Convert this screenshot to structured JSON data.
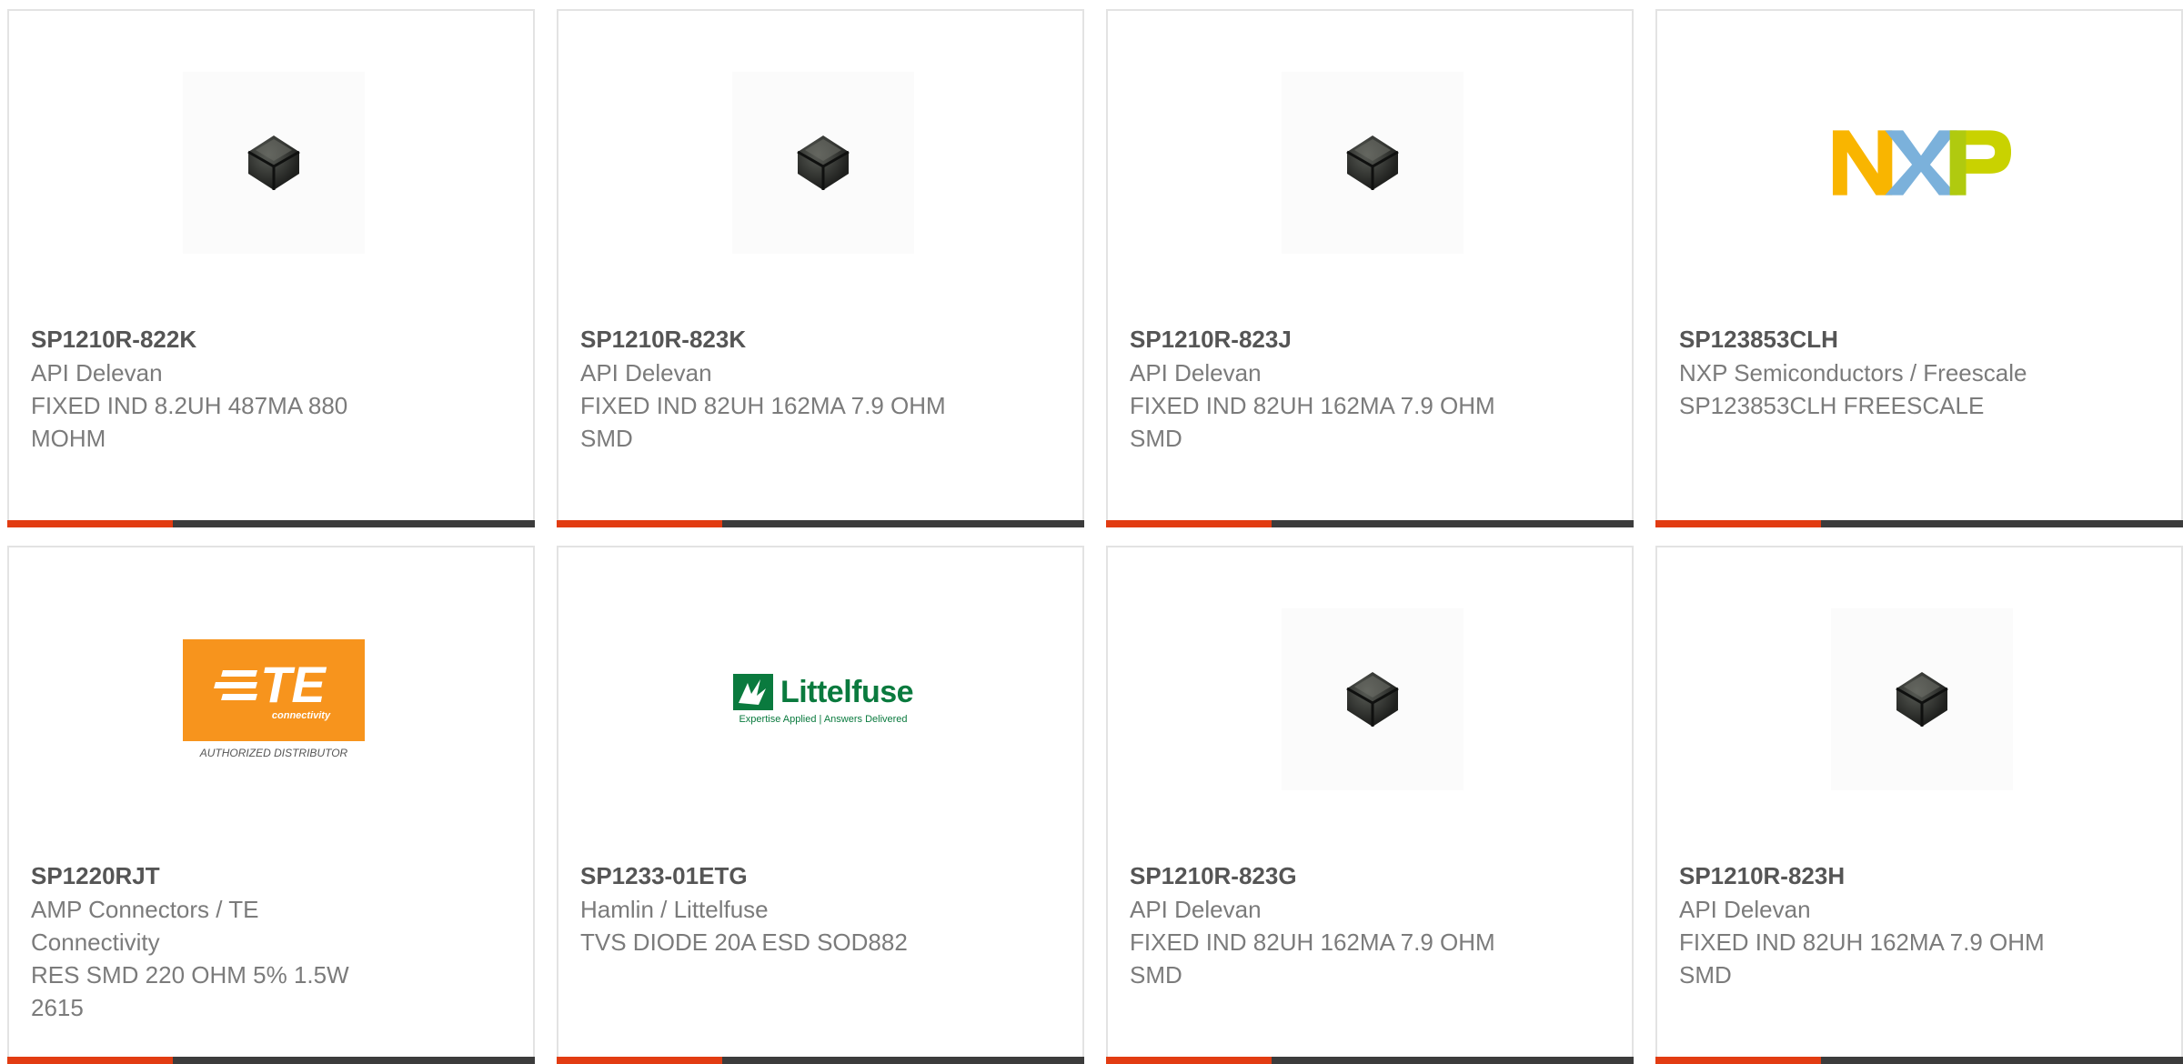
{
  "products": [
    {
      "part_number": "SP1210R-822K",
      "manufacturer": "API Delevan",
      "description": "FIXED IND 8.2UH 487MA 880 MOHM",
      "image": "inductor-component-icon"
    },
    {
      "part_number": "SP1210R-823K",
      "manufacturer": "API Delevan",
      "description": "FIXED IND 82UH 162MA 7.9 OHM SMD",
      "image": "inductor-component-icon"
    },
    {
      "part_number": "SP1210R-823J",
      "manufacturer": "API Delevan",
      "description": "FIXED IND 82UH 162MA 7.9 OHM SMD",
      "image": "inductor-component-icon"
    },
    {
      "part_number": "SP123853CLH",
      "manufacturer": "NXP Semiconductors / Freescale",
      "description": "SP123853CLH FREESCALE",
      "image": "nxp-logo"
    },
    {
      "part_number": "SP1220RJT",
      "manufacturer": "AMP Connectors / TE Connectivity",
      "description": "RES SMD 220 OHM 5% 1.5W 2615",
      "image": "te-connectivity-logo"
    },
    {
      "part_number": "SP1233-01ETG",
      "manufacturer": "Hamlin / Littelfuse",
      "description": "TVS DIODE 20A ESD SOD882",
      "image": "littelfuse-logo"
    },
    {
      "part_number": "SP1210R-823G",
      "manufacturer": "API Delevan",
      "description": "FIXED IND 82UH 162MA 7.9 OHM SMD",
      "image": "inductor-component-icon"
    },
    {
      "part_number": "SP1210R-823H",
      "manufacturer": "API Delevan",
      "description": "FIXED IND 82UH 162MA 7.9 OHM SMD",
      "image": "inductor-component-icon"
    }
  ],
  "logos": {
    "nxp": "NXP",
    "te_mark": "TE",
    "te_sub": "connectivity",
    "te_caption": "AUTHORIZED DISTRIBUTOR",
    "littelfuse_name": "Littelfuse",
    "littelfuse_tagline": "Expertise Applied | Answers Delivered"
  },
  "colors": {
    "accent_bar": "#e23c12",
    "dark_bar": "#3c3c3c",
    "te_orange": "#f7941d",
    "littelfuse_green": "#0a7a3e"
  }
}
